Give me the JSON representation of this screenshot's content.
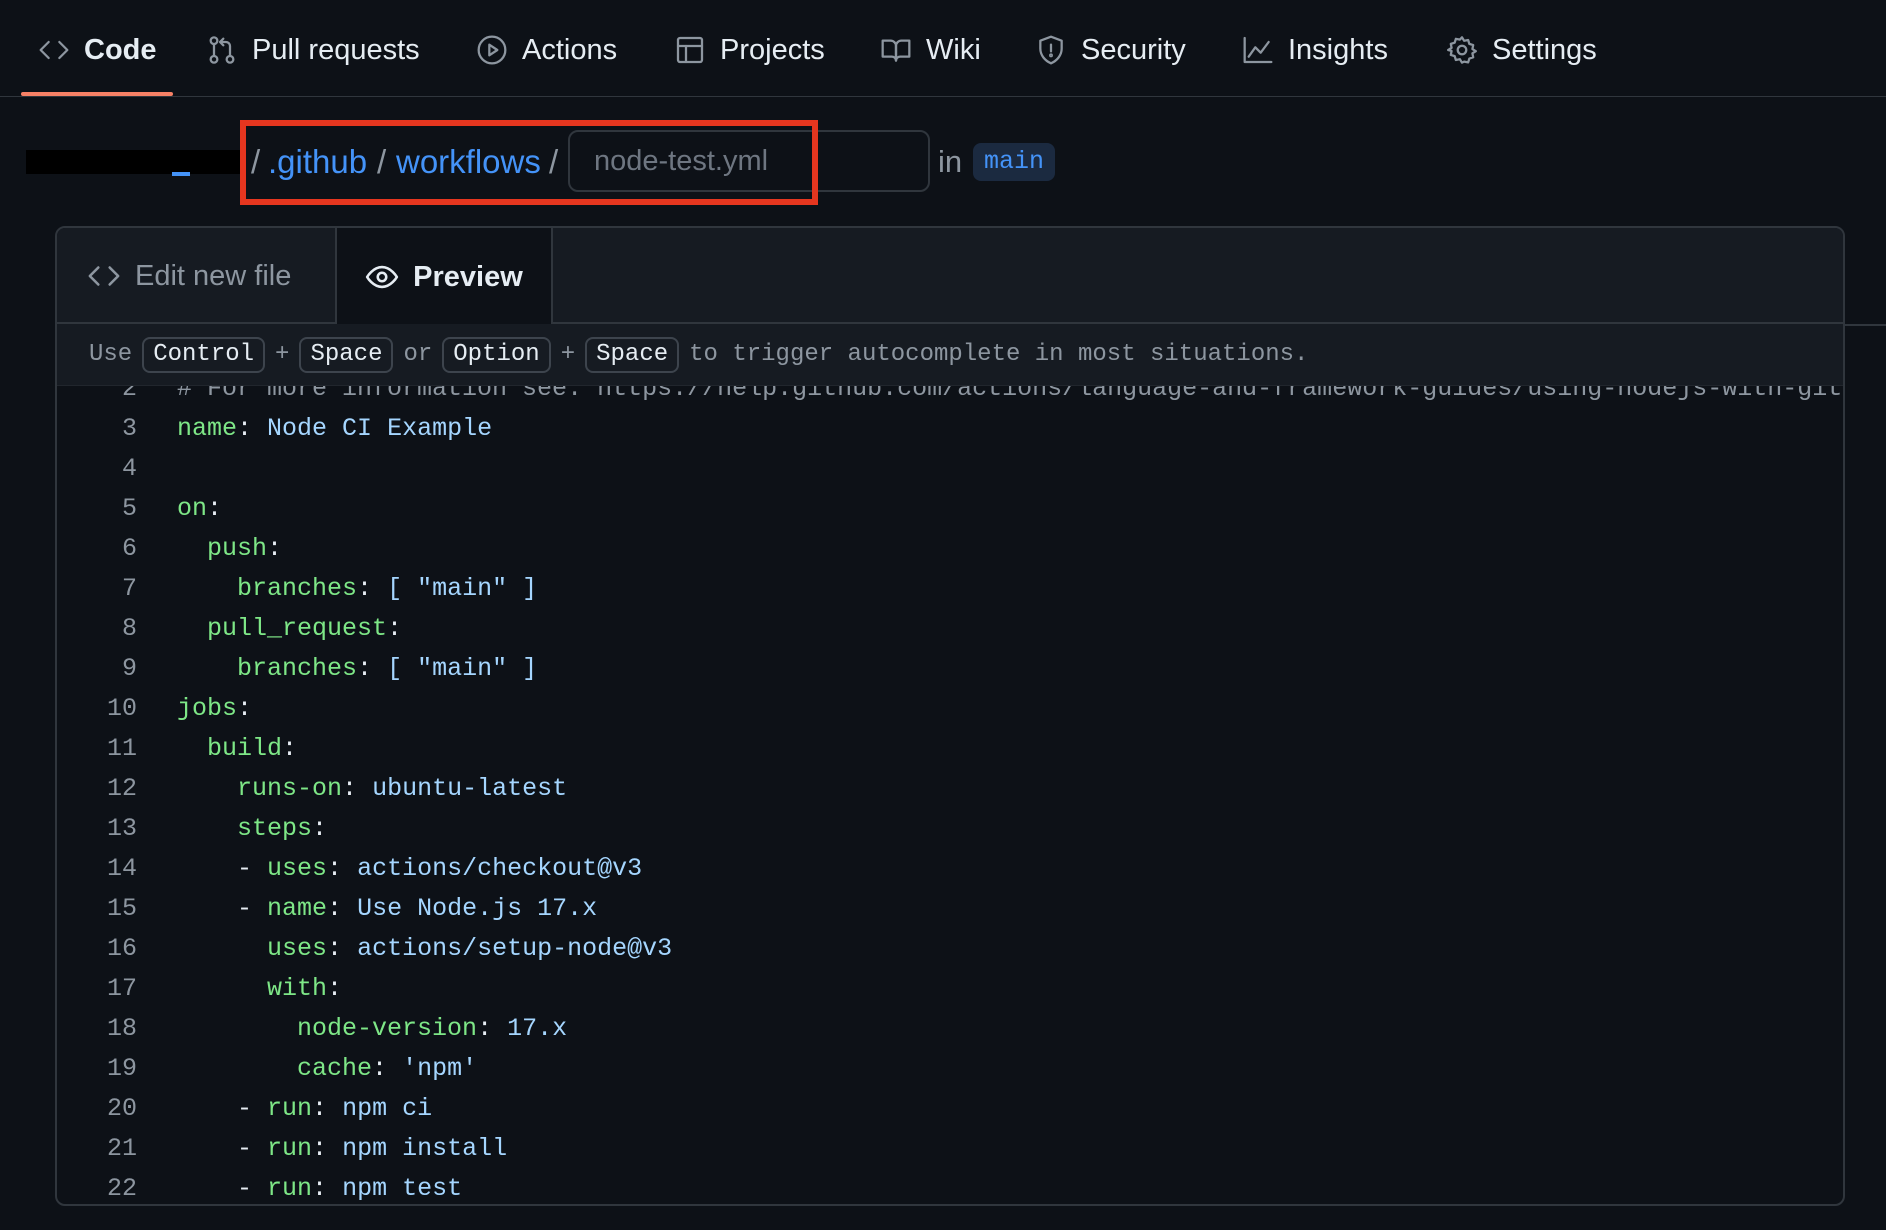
{
  "nav": {
    "tabs": [
      {
        "label": "Code",
        "icon": "code-icon",
        "active": true
      },
      {
        "label": "Pull requests",
        "icon": "git-pull-request-icon"
      },
      {
        "label": "Actions",
        "icon": "play-icon"
      },
      {
        "label": "Projects",
        "icon": "table-icon"
      },
      {
        "label": "Wiki",
        "icon": "book-icon"
      },
      {
        "label": "Security",
        "icon": "shield-icon"
      },
      {
        "label": "Insights",
        "icon": "graph-icon"
      },
      {
        "label": "Settings",
        "icon": "gear-icon"
      }
    ],
    "accent_color": "#f78166"
  },
  "breadcrumb": {
    "sep1": "/",
    "dir1": ".github",
    "sep2": "/",
    "dir2": "workflows",
    "sep3": "/",
    "filename_placeholder": "node-test.yml",
    "filename_value": "",
    "in_label": "in",
    "branch": "main",
    "highlight_color": "#e5361f"
  },
  "editor": {
    "tabs": {
      "edit": "Edit new file",
      "preview": "Preview"
    },
    "hint": {
      "use": "Use",
      "key1": "Control",
      "plus1": "+",
      "key2": "Space",
      "or": "or",
      "key3": "Option",
      "plus2": "+",
      "key4": "Space",
      "tail": "to trigger autocomplete in most situations."
    },
    "lines": [
      {
        "n": "2",
        "indent": "",
        "text": "# For more information see: https://help.github.com/actions/language-and-framework-guides/using-nodejs-with-github-actions"
      },
      {
        "n": "3",
        "indent": "",
        "key": "name",
        "val": "Node CI Example"
      },
      {
        "n": "4",
        "indent": "",
        "text": ""
      },
      {
        "n": "5",
        "indent": "",
        "key": "on",
        "val": ""
      },
      {
        "n": "6",
        "indent": "  ",
        "key": "push",
        "val": ""
      },
      {
        "n": "7",
        "indent": "    ",
        "key": "branches",
        "val": "[ \"main\" ]"
      },
      {
        "n": "8",
        "indent": "  ",
        "key": "pull_request",
        "val": ""
      },
      {
        "n": "9",
        "indent": "    ",
        "key": "branches",
        "val": "[ \"main\" ]"
      },
      {
        "n": "10",
        "indent": "",
        "key": "jobs",
        "val": ""
      },
      {
        "n": "11",
        "indent": "  ",
        "key": "build",
        "val": ""
      },
      {
        "n": "12",
        "indent": "    ",
        "key": "runs-on",
        "val": "ubuntu-latest"
      },
      {
        "n": "13",
        "indent": "    ",
        "key": "steps",
        "val": ""
      },
      {
        "n": "14",
        "indent": "    - ",
        "key": "uses",
        "val": "actions/checkout@v3"
      },
      {
        "n": "15",
        "indent": "    - ",
        "key": "name",
        "val": "Use Node.js 17.x"
      },
      {
        "n": "16",
        "indent": "      ",
        "key": "uses",
        "val": "actions/setup-node@v3"
      },
      {
        "n": "17",
        "indent": "      ",
        "key": "with",
        "val": ""
      },
      {
        "n": "18",
        "indent": "        ",
        "key": "node-version",
        "val": "17.x"
      },
      {
        "n": "19",
        "indent": "        ",
        "key": "cache",
        "val": "'npm'"
      },
      {
        "n": "20",
        "indent": "    - ",
        "key": "run",
        "val": "npm ci"
      },
      {
        "n": "21",
        "indent": "    - ",
        "key": "run",
        "val": "npm install"
      },
      {
        "n": "22",
        "indent": "    - ",
        "key": "run",
        "val": "npm test"
      }
    ]
  }
}
